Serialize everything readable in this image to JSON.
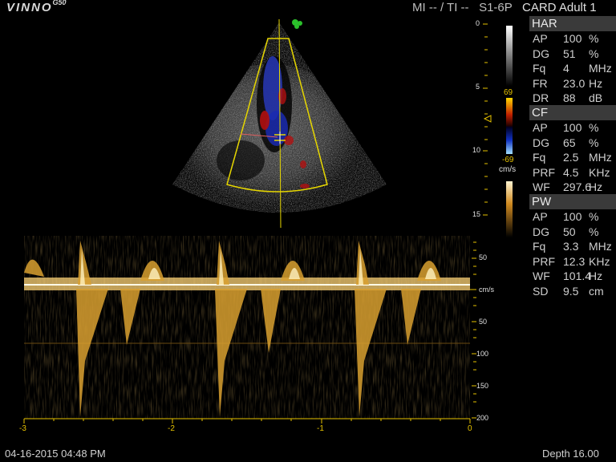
{
  "header": {
    "logo": "VINNO",
    "logo_sup": "G50",
    "mode": "MI -- / TI --",
    "probe": "S1-6P",
    "preset": "CARD Adult 1"
  },
  "panels": [
    {
      "title": "HAR",
      "rows": [
        {
          "k": "AP",
          "v": "100",
          "u": "%"
        },
        {
          "k": "DG",
          "v": "51",
          "u": "%"
        },
        {
          "k": "Fq",
          "v": "4",
          "u": "MHz"
        },
        {
          "k": "FR",
          "v": "23.0",
          "u": "Hz"
        },
        {
          "k": "DR",
          "v": "88",
          "u": "dB"
        }
      ]
    },
    {
      "title": "CF",
      "rows": [
        {
          "k": "AP",
          "v": "100",
          "u": "%"
        },
        {
          "k": "DG",
          "v": "65",
          "u": "%"
        },
        {
          "k": "Fq",
          "v": "2.5",
          "u": "MHz"
        },
        {
          "k": "PRF",
          "v": "4.5",
          "u": "KHz"
        },
        {
          "k": "WF",
          "v": "297.6",
          "u": "Hz"
        }
      ]
    },
    {
      "title": "PW",
      "rows": [
        {
          "k": "AP",
          "v": "100",
          "u": "%"
        },
        {
          "k": "DG",
          "v": "50",
          "u": "%"
        },
        {
          "k": "Fq",
          "v": "3.3",
          "u": "MHz"
        },
        {
          "k": "PRF",
          "v": "12.3",
          "u": "KHz"
        },
        {
          "k": "WF",
          "v": "101.4",
          "u": "Hz"
        },
        {
          "k": "SD",
          "v": "9.5",
          "u": "cm"
        }
      ]
    }
  ],
  "depth_scale": [
    "0",
    "5",
    "10",
    "15"
  ],
  "color_map": {
    "top": "69",
    "bottom": "-69",
    "unit": "cm/s"
  },
  "velocity_scale": [
    "50",
    "cm/s",
    "50",
    "100",
    "150",
    "200"
  ],
  "time_scale": [
    "-3",
    "-2",
    "-1",
    "0"
  ],
  "footer": {
    "datetime": "04-16-2015 04:48 PM",
    "depth": "Depth 16.00"
  },
  "colors": {
    "accent": "#e6c200",
    "panel_header": "#3a3a3a",
    "doppler": "#d9a030"
  }
}
